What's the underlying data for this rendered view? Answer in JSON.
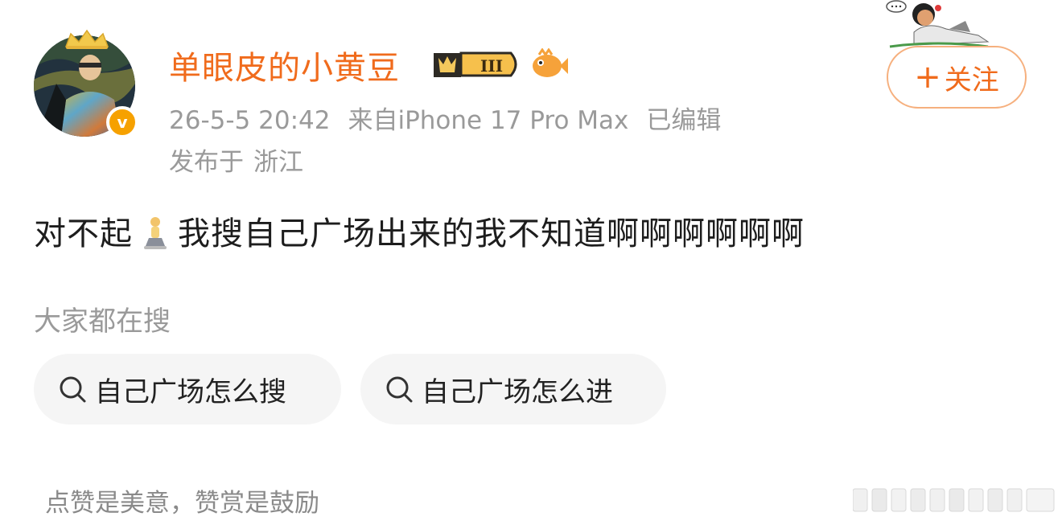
{
  "user": {
    "name": "单眼皮的小黄豆",
    "vip_level": "III",
    "verified_mark": "v",
    "avatar": "avatar-icon"
  },
  "meta": {
    "datetime": "26-5-5 20:42",
    "source": "来自iPhone 17 Pro Max",
    "edited": "已编辑"
  },
  "location": {
    "prefix": "发布于",
    "place": "浙江"
  },
  "follow_button": {
    "plus": "+",
    "label": "关注"
  },
  "post": {
    "text_before_emoji": "对不起",
    "emoji": "person-kneeling-emoji",
    "text_after_emoji": "我搜自己广场出来的我不知道啊啊啊啊啊啊"
  },
  "search_section": {
    "title": "大家都在搜",
    "chips": [
      {
        "label": "自己广场怎么搜"
      },
      {
        "label": "自己广场怎么进"
      }
    ]
  },
  "footer": {
    "text": "点赞是美意，赞赏是鼓励"
  },
  "colors": {
    "brand_orange": "#f06b1c",
    "gray_text": "#9a9a9a",
    "chip_bg": "#f5f5f5",
    "verified_badge": "#f6a100"
  }
}
